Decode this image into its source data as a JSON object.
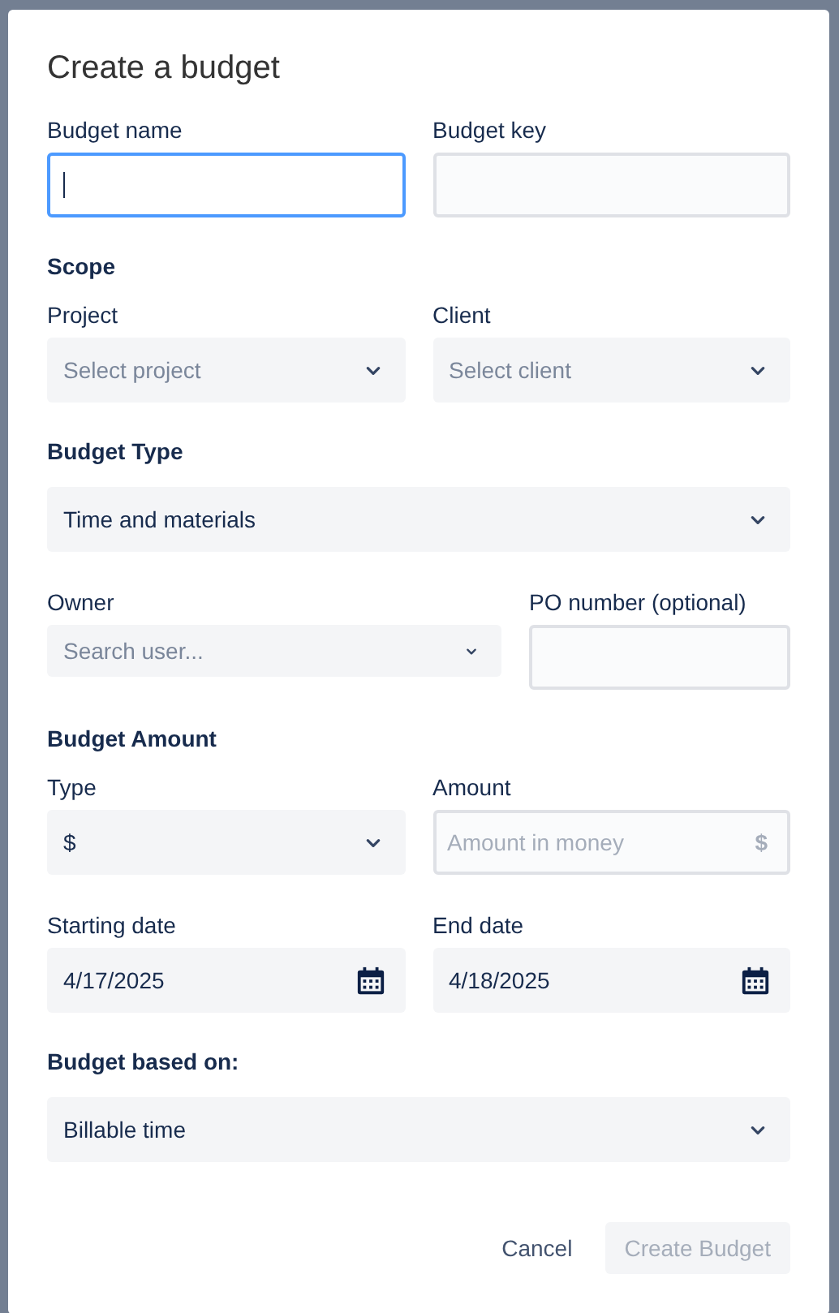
{
  "dialog": {
    "title": "Create a budget"
  },
  "rows": [
    {
      "kind": "fields",
      "fields": [
        {
          "kind": "text",
          "label": "Budget name",
          "focused": true
        },
        {
          "kind": "text",
          "label": "Budget key",
          "focused": false
        }
      ]
    },
    {
      "kind": "heading",
      "text": "Scope"
    },
    {
      "kind": "fields",
      "fields": [
        {
          "kind": "select",
          "label": "Project",
          "placeholder": "Select project"
        },
        {
          "kind": "select",
          "label": "Client",
          "placeholder": "Select client"
        }
      ]
    },
    {
      "kind": "heading",
      "text": "Budget Type"
    },
    {
      "kind": "fields",
      "fields": [
        {
          "kind": "select",
          "value": "Time and materials"
        }
      ]
    },
    {
      "kind": "fields",
      "fields": [
        {
          "kind": "user-picker",
          "label": "Owner",
          "placeholder": "Search user..."
        },
        {
          "kind": "text",
          "label": "PO number (optional)",
          "focused": false
        }
      ]
    },
    {
      "kind": "heading",
      "text": "Budget Amount"
    },
    {
      "kind": "fields",
      "fields": [
        {
          "kind": "select",
          "label": "Type",
          "value": "$"
        },
        {
          "kind": "money",
          "label": "Amount",
          "placeholder": "Amount in money",
          "suffix": "$"
        }
      ]
    },
    {
      "kind": "fields",
      "fields": [
        {
          "kind": "date",
          "label": "Starting date",
          "value": "4/17/2025"
        },
        {
          "kind": "date",
          "label": "End date",
          "value": "4/18/2025"
        }
      ]
    },
    {
      "kind": "heading",
      "text": "Budget based on:"
    },
    {
      "kind": "fields",
      "fields": [
        {
          "kind": "select",
          "value": "Billable time"
        }
      ]
    }
  ],
  "buttons": [
    {
      "label": "Cancel",
      "kind": "subtle",
      "disabled": false
    },
    {
      "label": "Create Budget",
      "kind": "primary",
      "disabled": true
    }
  ]
}
